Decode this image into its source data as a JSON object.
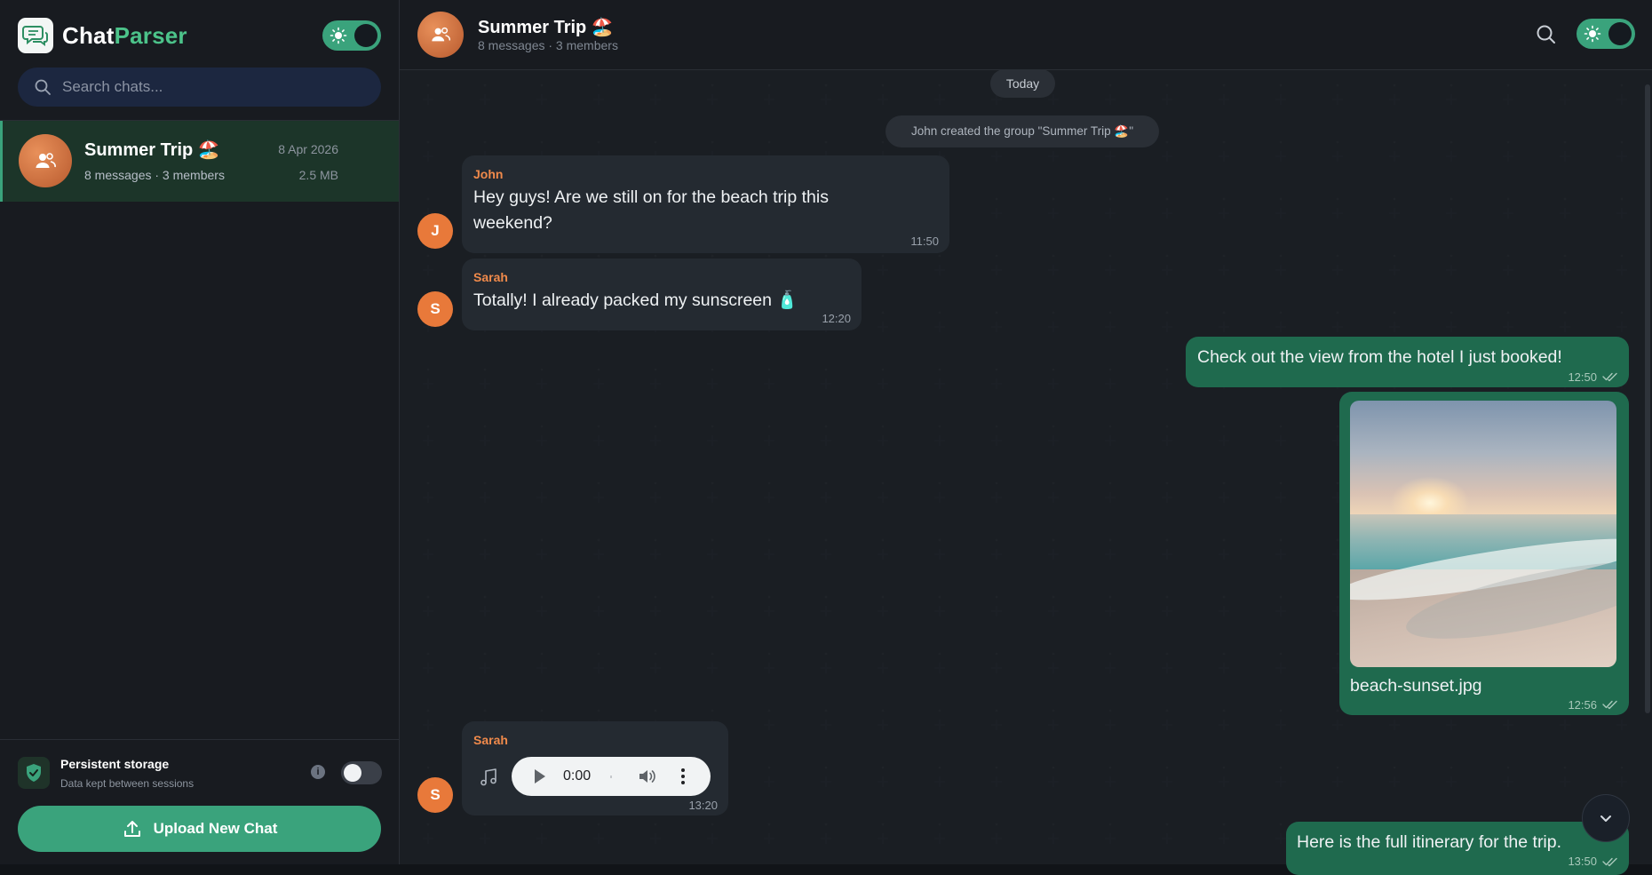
{
  "sidebar": {
    "brand": {
      "part1": "Chat",
      "part2": "Parser"
    },
    "search": {
      "placeholder": "Search chats..."
    },
    "chats": [
      {
        "title": "Summer Trip 🏖️",
        "subtitle": "8 messages · 3 members",
        "date": "8 Apr 2026",
        "size": "2.5 MB"
      }
    ],
    "storage": {
      "title": "Persistent storage",
      "subtitle": "Data kept between sessions",
      "info": "i",
      "enabled": false
    },
    "upload_label": "Upload New Chat"
  },
  "header": {
    "title": "Summer Trip 🏖️",
    "subtitle": "8 messages · 3 members"
  },
  "messages": {
    "date_pill": "Today",
    "system": "John created the group \"Summer Trip 🏖️\"",
    "m1": {
      "avatar": "J",
      "sender": "John",
      "text": "Hey guys! Are we still on for the beach trip this weekend?",
      "time": "11:50"
    },
    "m2": {
      "avatar": "S",
      "sender": "Sarah",
      "text": "Totally! I already packed my sunscreen 🧴",
      "time": "12:20"
    },
    "m3": {
      "text": "Check out the view from the hotel I just booked!",
      "time": "12:50"
    },
    "m4": {
      "caption": "beach-sunset.jpg",
      "time": "12:56"
    },
    "m5": {
      "avatar": "S",
      "sender": "Sarah",
      "audio_time": "0:00",
      "time": "13:20"
    },
    "m6": {
      "text": "Here is the full itinerary for the trip.",
      "time": "13:50"
    }
  },
  "colors": {
    "accent": "#3aa37c",
    "outgoing": "#1f6a4e",
    "incoming": "#242a31",
    "sender_name": "#f08a4b",
    "avatar": "#e8793a"
  },
  "icons": [
    "chat-logo-icon",
    "sun-icon",
    "search-icon",
    "group-icon",
    "shield-icon",
    "info-icon",
    "upload-icon",
    "music-note-icon",
    "play-icon",
    "volume-icon",
    "more-vertical-icon",
    "double-check-icon",
    "chevron-down-icon"
  ]
}
